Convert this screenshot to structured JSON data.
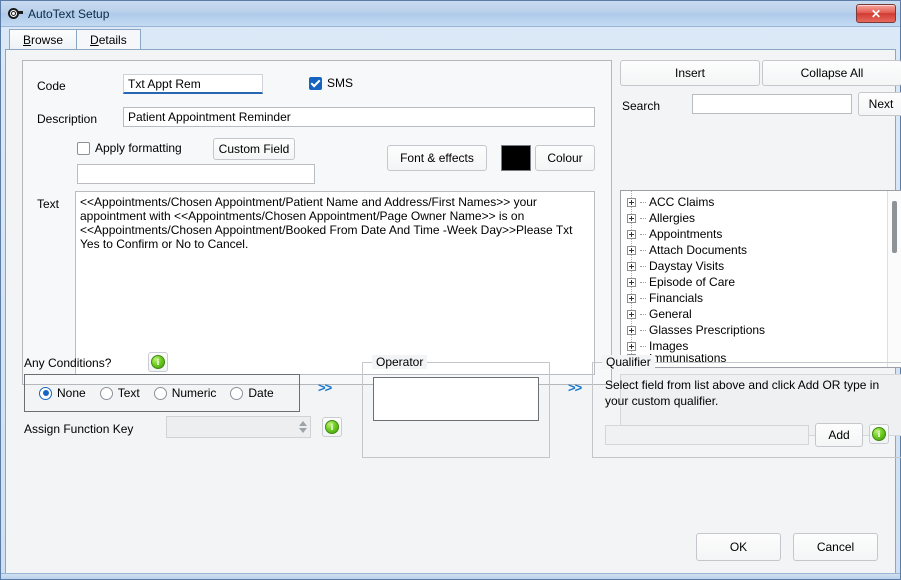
{
  "window": {
    "title": "AutoText Setup",
    "icon": "autotext-icon",
    "close_label": "✕"
  },
  "tabs": [
    {
      "label": "Browse",
      "accel": "B",
      "active": false
    },
    {
      "label": "Details",
      "accel": "D",
      "active": true
    }
  ],
  "form": {
    "code_label": "Code",
    "code_value": "Txt Appt Rem",
    "sms_label": "SMS",
    "sms_checked": true,
    "description_label": "Description",
    "description_value": "Patient Appointment Reminder",
    "apply_formatting_label": "Apply formatting",
    "apply_formatting_checked": false,
    "custom_field_label": "Custom Field",
    "font_name_value": "",
    "font_effects_label": "Font & effects",
    "colour_label": "Colour",
    "colour_swatch": "#000000",
    "text_label": "Text",
    "text_value": "<<Appointments/Chosen Appointment/Patient Name and Address/First Names>> your appointment with <<Appointments/Chosen Appointment/Page Owner Name>> is on <<Appointments/Chosen Appointment/Booked From Date And Time -Week Day>>Please Txt Yes to Confirm or No to Cancel."
  },
  "field_panel": {
    "insert_label": "Insert",
    "collapse_all_label": "Collapse All",
    "search_label": "Search",
    "search_value": "",
    "next_label": "Next",
    "tree_nodes": [
      "ACC Claims",
      "Allergies",
      "Appointments",
      "Attach Documents",
      "Daystay Visits",
      "Episode of Care",
      "Financials",
      "General",
      "Glasses Prescriptions",
      "Images",
      "Immunisations"
    ]
  },
  "conditions": {
    "title": "Any Conditions?",
    "info_icon": "info-icon",
    "options": [
      {
        "label": "None",
        "selected": true
      },
      {
        "label": "Text",
        "selected": false
      },
      {
        "label": "Numeric",
        "selected": false
      },
      {
        "label": "Date",
        "selected": false
      }
    ],
    "assign_function_key_label": "Assign Function Key",
    "assign_function_key_value": "",
    "arrows_label": ">>"
  },
  "operator": {
    "title": "Operator",
    "value": "",
    "arrows_label": ">>"
  },
  "qualifier": {
    "title": "Qualifier",
    "instruction": "Select field from list above and click Add OR type in your custom qualifier.",
    "value": "",
    "add_label": "Add"
  },
  "footer": {
    "ok_label": "OK",
    "cancel_label": "Cancel"
  },
  "colors": {
    "accent": "#1565c0",
    "title_bar": "#aecaea",
    "close_red": "#cf3b32",
    "arrow_blue": "#1878d0",
    "info_green": "#6fce20"
  }
}
